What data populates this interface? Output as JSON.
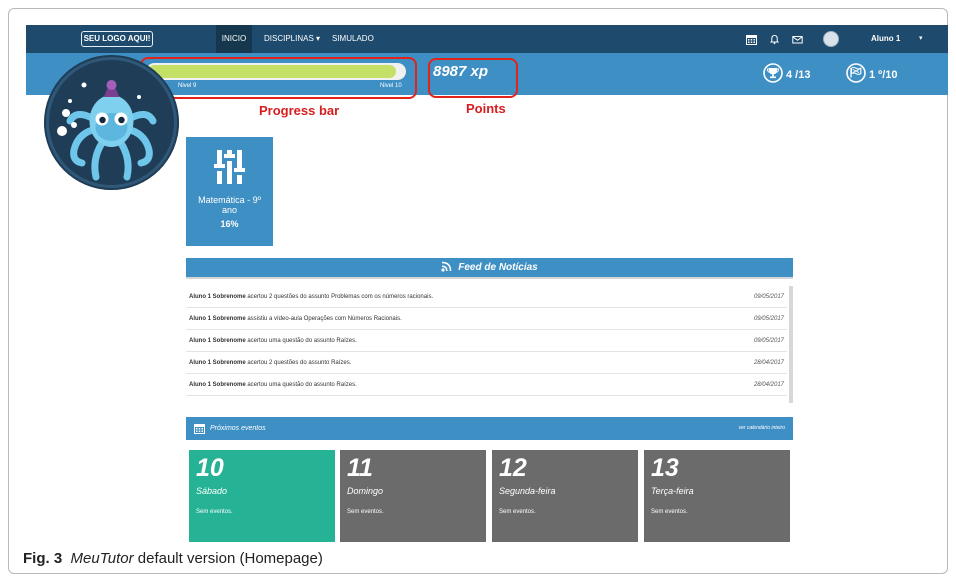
{
  "nav": {
    "logo": "SEU LOGO AQUI!",
    "items": [
      "INICIO",
      "DISCIPLINAS ▾",
      "SIMULADO"
    ],
    "user": "Aluno 1",
    "caret": "▾",
    "icons": [
      "calendar-icon",
      "bell-icon",
      "mail-icon"
    ]
  },
  "progress": {
    "level_start": "Nivel 9",
    "level_end": "Nivel 10",
    "fill_fraction": 0.97,
    "xp": "8987 xp"
  },
  "stats": {
    "trophies": "4 /13",
    "rank": "1 º/10"
  },
  "annotations": {
    "progress_label": "Progress bar",
    "points_label": "Points",
    "color": "#e2231a"
  },
  "subject": {
    "name": "Matemática - 9º ano",
    "percent": "16%"
  },
  "feed": {
    "title": "Feed de Notícias",
    "items": [
      {
        "user": "Aluno 1 Sobrenome",
        "text": " acertou 2 questões do assunto Problemas com os números racionais.",
        "date": "09/05/2017"
      },
      {
        "user": "Aluno 1 Sobrenome",
        "text": " assistiu a vídeo-aula Operações com Números Racionais.",
        "date": "09/05/2017"
      },
      {
        "user": "Aluno 1 Sobrenome",
        "text": " acertou uma questão do assunto Raízes.",
        "date": "09/05/2017"
      },
      {
        "user": "Aluno 1 Sobrenome",
        "text": " acertou 2 questões do assunto Raízes.",
        "date": "28/04/2017"
      },
      {
        "user": "Aluno 1 Sobrenome",
        "text": " acertou uma questão do assunto Raízes.",
        "date": "28/04/2017"
      }
    ]
  },
  "events": {
    "title": "Próximos eventos",
    "link": "ver calendário inteiro",
    "days": [
      {
        "num": "10",
        "name": "Sábado",
        "status": "Sem eventos.",
        "color": "#26b294"
      },
      {
        "num": "11",
        "name": "Domingo",
        "status": "Sem eventos.",
        "color": "#6b6b6b"
      },
      {
        "num": "12",
        "name": "Segunda-feira",
        "status": "Sem eventos.",
        "color": "#6b6b6b"
      },
      {
        "num": "13",
        "name": "Terça-feira",
        "status": "Sem eventos.",
        "color": "#6b6b6b"
      }
    ]
  },
  "caption": {
    "fig": "Fig. 3",
    "app": "MeuTutor",
    "rest": " default version (Homepage)"
  },
  "colors": {
    "navbar": "#1d4a6d",
    "band": "#3e8fc4",
    "progress_fill": "#c4e067",
    "today": "#26b294",
    "day": "#6b6b6b"
  }
}
